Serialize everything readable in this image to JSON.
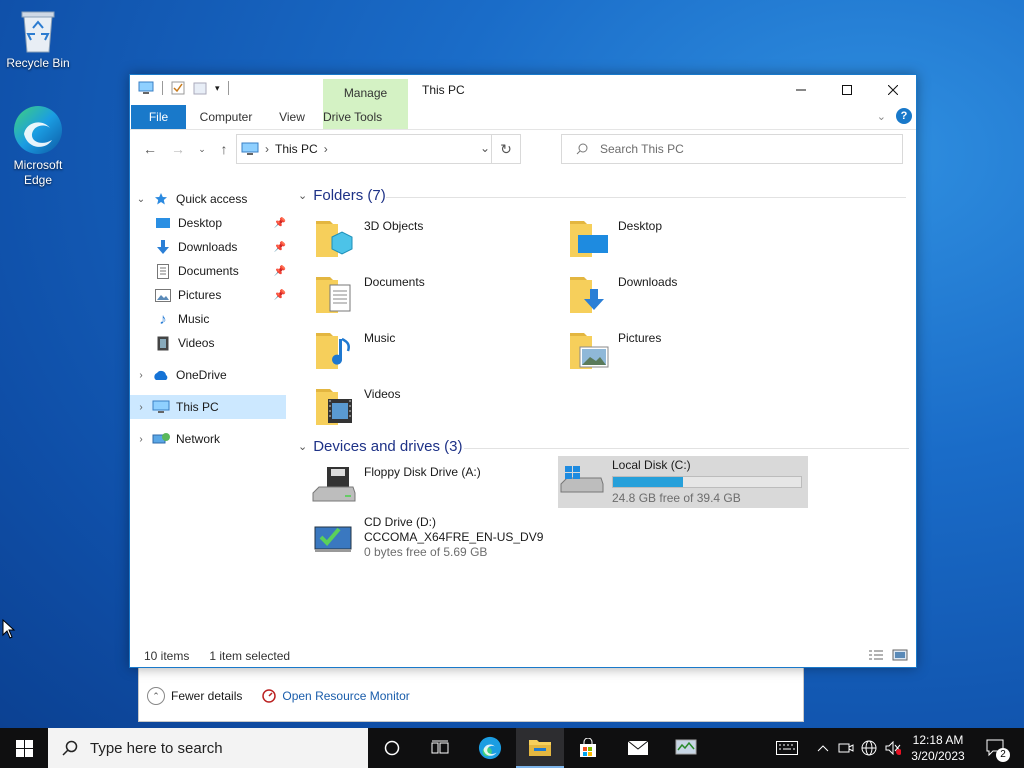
{
  "desktop": {
    "icons": [
      {
        "label": "Recycle Bin"
      },
      {
        "label": "Microsoft Edge"
      }
    ]
  },
  "task_manager_bg": {
    "fewer_details": "Fewer details",
    "resource_monitor": "Open Resource Monitor"
  },
  "explorer": {
    "title": "This PC",
    "contextual_tab_header": "Manage",
    "ribbon_tabs": [
      "File",
      "Computer",
      "View",
      "Drive Tools"
    ],
    "address_path": "This PC",
    "search_placeholder": "Search This PC",
    "nav": {
      "quick_access": "Quick access",
      "quick_items": [
        {
          "label": "Desktop",
          "pinned": true
        },
        {
          "label": "Downloads",
          "pinned": true
        },
        {
          "label": "Documents",
          "pinned": true
        },
        {
          "label": "Pictures",
          "pinned": true
        },
        {
          "label": "Music",
          "pinned": false
        },
        {
          "label": "Videos",
          "pinned": false
        }
      ],
      "onedrive": "OneDrive",
      "this_pc": "This PC",
      "network": "Network"
    },
    "folders_header": "Folders (7)",
    "folders": [
      "3D Objects",
      "Desktop",
      "Documents",
      "Downloads",
      "Music",
      "Pictures",
      "Videos"
    ],
    "devices_header": "Devices and drives (3)",
    "drives": [
      {
        "name": "Floppy Disk Drive (A:)",
        "free_text": "",
        "used_fraction": null
      },
      {
        "name": "Local Disk (C:)",
        "free_text": "24.8 GB free of 39.4 GB",
        "used_fraction": 0.37
      },
      {
        "name": "CD Drive (D:)",
        "label2": "CCCOMA_X64FRE_EN-US_DV9",
        "free_text": "0 bytes free of 5.69 GB",
        "used_fraction": null
      }
    ],
    "status": {
      "items": "10 items",
      "selected": "1 item selected"
    }
  },
  "taskbar": {
    "search_placeholder": "Type here to search",
    "time": "12:18 AM",
    "date": "3/20/2023",
    "notification_count": "2"
  },
  "colors": {
    "accent": "#1979ca",
    "drive_tools": "#d4f2c4",
    "selection": "#cce8ff",
    "usage_bar": "#26a0da"
  }
}
